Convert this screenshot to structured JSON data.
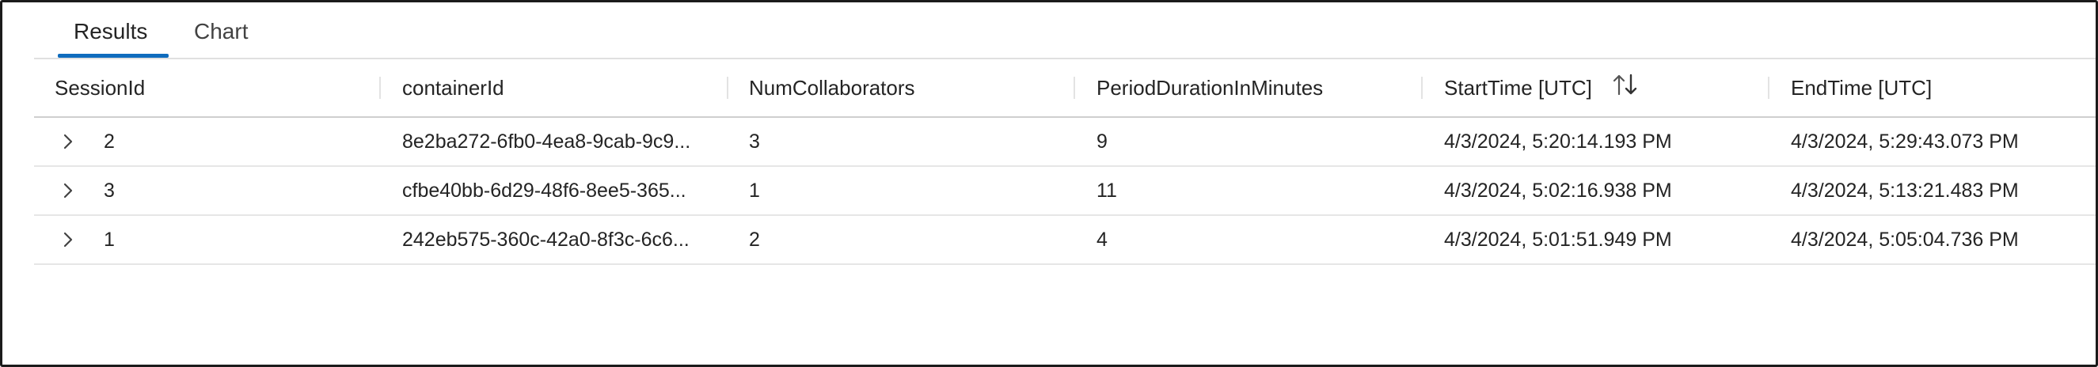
{
  "tabs": [
    {
      "label": "Results",
      "active": true
    },
    {
      "label": "Chart",
      "active": false
    }
  ],
  "columns": [
    "SessionId",
    "containerId",
    "NumCollaborators",
    "PeriodDurationInMinutes",
    "StartTime [UTC]",
    "EndTime [UTC]"
  ],
  "rows": [
    {
      "session_id": "2",
      "container_id": "8e2ba272-6fb0-4ea8-9cab-9c9...",
      "num_collaborators": "3",
      "period_duration": "9",
      "start_time": "4/3/2024, 5:20:14.193 PM",
      "end_time": "4/3/2024, 5:29:43.073 PM"
    },
    {
      "session_id": "3",
      "container_id": "cfbe40bb-6d29-48f6-8ee5-365...",
      "num_collaborators": "1",
      "period_duration": "11",
      "start_time": "4/3/2024, 5:02:16.938 PM",
      "end_time": "4/3/2024, 5:13:21.483 PM"
    },
    {
      "session_id": "1",
      "container_id": "242eb575-360c-42a0-8f3c-6c6...",
      "num_collaborators": "2",
      "period_duration": "4",
      "start_time": "4/3/2024, 5:01:51.949 PM",
      "end_time": "4/3/2024, 5:05:04.736 PM"
    }
  ],
  "icons": {
    "expand": "chevron-right-icon",
    "sort": "sort-arrows-icon"
  },
  "colors": {
    "accent": "#0f6cbd",
    "text": "#242424",
    "border": "#1b1b1b"
  }
}
